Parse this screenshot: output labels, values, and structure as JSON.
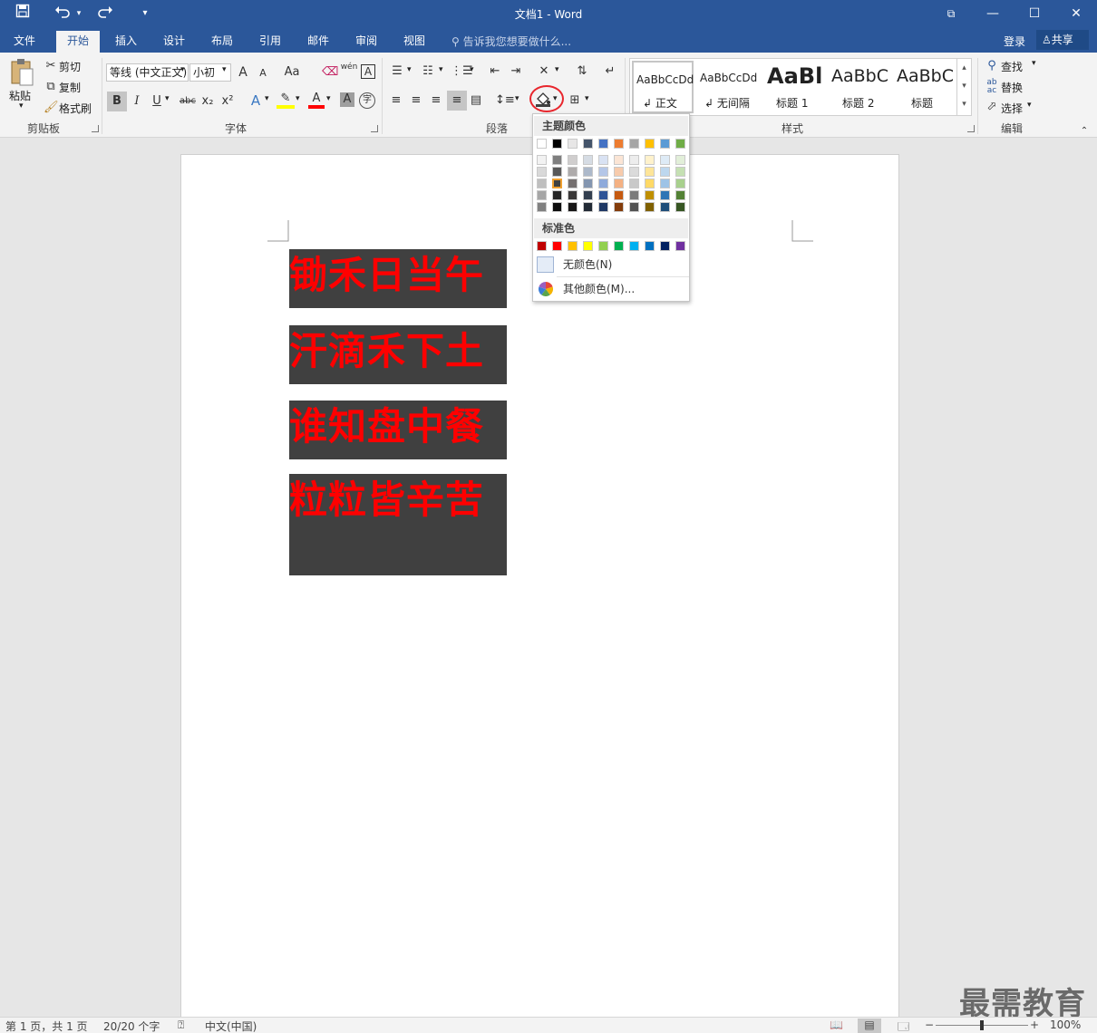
{
  "window": {
    "title": "文档1 - Word",
    "minimize": "—",
    "restore": "☐",
    "close": "✕",
    "ribbon_display": "⧉"
  },
  "quick_access": {
    "save_icon": "save-icon",
    "undo_icon": "undo-icon",
    "redo_icon": "redo-icon",
    "customize_icon": "customize-qat-icon"
  },
  "tabs": [
    "文件",
    "开始",
    "插入",
    "设计",
    "布局",
    "引用",
    "邮件",
    "审阅",
    "视图"
  ],
  "active_tab": "开始",
  "tell_me": "告诉我您想要做什么...",
  "account": {
    "signin": "登录",
    "share": "共享"
  },
  "clipboard": {
    "paste": "粘贴",
    "cut": "剪切",
    "copy": "复制",
    "format_painter": "格式刷",
    "group": "剪贴板"
  },
  "font": {
    "name": "等线 (中文正文)",
    "size": "小初",
    "group": "字体",
    "grow": "A",
    "shrink": "A",
    "case": "Aa",
    "phonetic": "wén",
    "bold": "B",
    "italic": "I",
    "underline": "U",
    "strike": "abc",
    "sub": "x₂",
    "sup": "x²",
    "effects": "A",
    "char_border": "A",
    "char_shading": "A",
    "enclose": "字"
  },
  "paragraph": {
    "group": "段落"
  },
  "styles": {
    "group": "样式",
    "items": [
      {
        "preview": "AaBbCcDd",
        "name": "正文"
      },
      {
        "preview": "AaBbCcDd",
        "name": "无间隔"
      },
      {
        "preview": "AaBl",
        "name": "标题 1"
      },
      {
        "preview": "AaBbC",
        "name": "标题 2"
      },
      {
        "preview": "AaBbC",
        "name": "标题"
      }
    ]
  },
  "editing": {
    "group": "编辑",
    "find": "查找",
    "replace": "替换",
    "select": "选择"
  },
  "document": {
    "lines": [
      "锄禾日当午",
      "汗滴禾下土",
      "谁知盘中餐",
      "粒粒皆辛苦"
    ],
    "highlight_bg": "#404040",
    "text_color": "#ff0000"
  },
  "shading_menu": {
    "theme_header": "主题颜色",
    "theme_top": [
      "#ffffff",
      "#000000",
      "#e7e6e6",
      "#44546a",
      "#4472c4",
      "#ed7d31",
      "#a5a5a5",
      "#ffc000",
      "#5b9bd5",
      "#70ad47"
    ],
    "theme_shades": [
      [
        "#f2f2f2",
        "#d9d9d9",
        "#bfbfbf",
        "#a6a6a6",
        "#808080"
      ],
      [
        "#7f7f7f",
        "#595959",
        "#404040",
        "#262626",
        "#0d0d0d"
      ],
      [
        "#d0cece",
        "#aeabab",
        "#757070",
        "#3a3838",
        "#171616"
      ],
      [
        "#d6dce4",
        "#adb9ca",
        "#8496b0",
        "#333f4f",
        "#222a35"
      ],
      [
        "#d9e2f3",
        "#b4c6e7",
        "#8eaadb",
        "#2f5496",
        "#1f3864"
      ],
      [
        "#fbe5d5",
        "#f7cbac",
        "#f4b183",
        "#c55a11",
        "#833c0b"
      ],
      [
        "#ededed",
        "#dbdbdb",
        "#c9c9c9",
        "#7b7b7b",
        "#525252"
      ],
      [
        "#fff2cc",
        "#fee599",
        "#ffd966",
        "#bf8f00",
        "#7f6000"
      ],
      [
        "#deebf6",
        "#bdd7ee",
        "#9dc3e6",
        "#2e75b5",
        "#1f4e79"
      ],
      [
        "#e2efd9",
        "#c5e0b3",
        "#a8d08d",
        "#538135",
        "#375623"
      ]
    ],
    "selected": "#404040",
    "standard_header": "标准色",
    "standard": [
      "#c00000",
      "#ff0000",
      "#ffc000",
      "#ffff00",
      "#92d050",
      "#00b050",
      "#00b0f0",
      "#0070c0",
      "#002060",
      "#7030a0"
    ],
    "no_color": "无颜色(N)",
    "more_colors": "其他颜色(M)..."
  },
  "status": {
    "page": "第 1 页，共 1 页",
    "words": "20/20 个字",
    "language": "中文(中国)",
    "zoom": "100%",
    "zoom_level_pct": 100
  },
  "watermark": "最需教育"
}
